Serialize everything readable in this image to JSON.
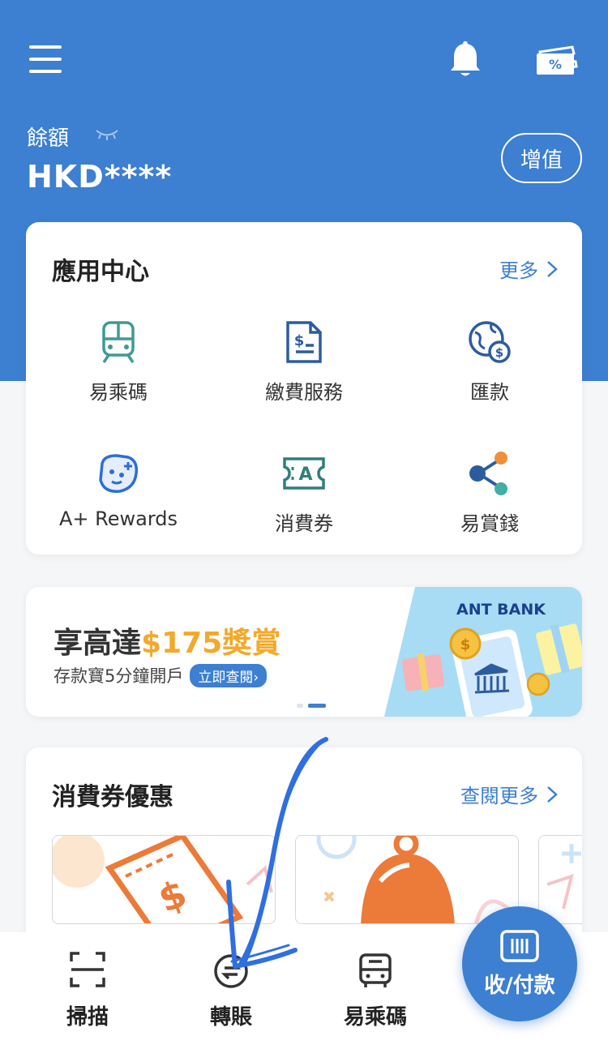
{
  "header": {
    "balance_label": "餘額",
    "balance_value": "HKD****",
    "topup_label": "增值",
    "background_color": "#3d7fd0"
  },
  "icons": {
    "menu": "menu-icon",
    "bell": "bell-icon",
    "coupon": "coupon-percent-icon",
    "eye": "eye-closed-icon"
  },
  "app_center": {
    "title": "應用中心",
    "more_label": "更多",
    "items": [
      {
        "label": "易乘碼",
        "icon": "train-icon"
      },
      {
        "label": "繳費服務",
        "icon": "bill-icon"
      },
      {
        "label": "匯款",
        "icon": "globe-dollar-icon"
      },
      {
        "label": "A+ Rewards",
        "icon": "rewards-face-icon"
      },
      {
        "label": "消費券",
        "icon": "voucher-icon"
      },
      {
        "label": "易賞錢",
        "icon": "share-points-icon"
      }
    ]
  },
  "banner": {
    "title_prefix": "享高達",
    "title_highlight": "$175獎賞",
    "subtitle": "存款寶5分鐘開戶",
    "cta": "立即查閱›",
    "brand": "ANT BANK",
    "pages": 2,
    "active_page": 2,
    "highlight_color": "#f2a92c"
  },
  "coupons": {
    "title": "消費券優惠",
    "more_label": "查閱更多"
  },
  "bottom_nav": {
    "items": [
      {
        "label": "掃描",
        "icon": "scan-icon"
      },
      {
        "label": "轉賬",
        "icon": "transfer-icon"
      },
      {
        "label": "易乘碼",
        "icon": "bus-icon"
      }
    ],
    "pay_label": "收/付款",
    "pay_icon": "barcode-icon"
  }
}
